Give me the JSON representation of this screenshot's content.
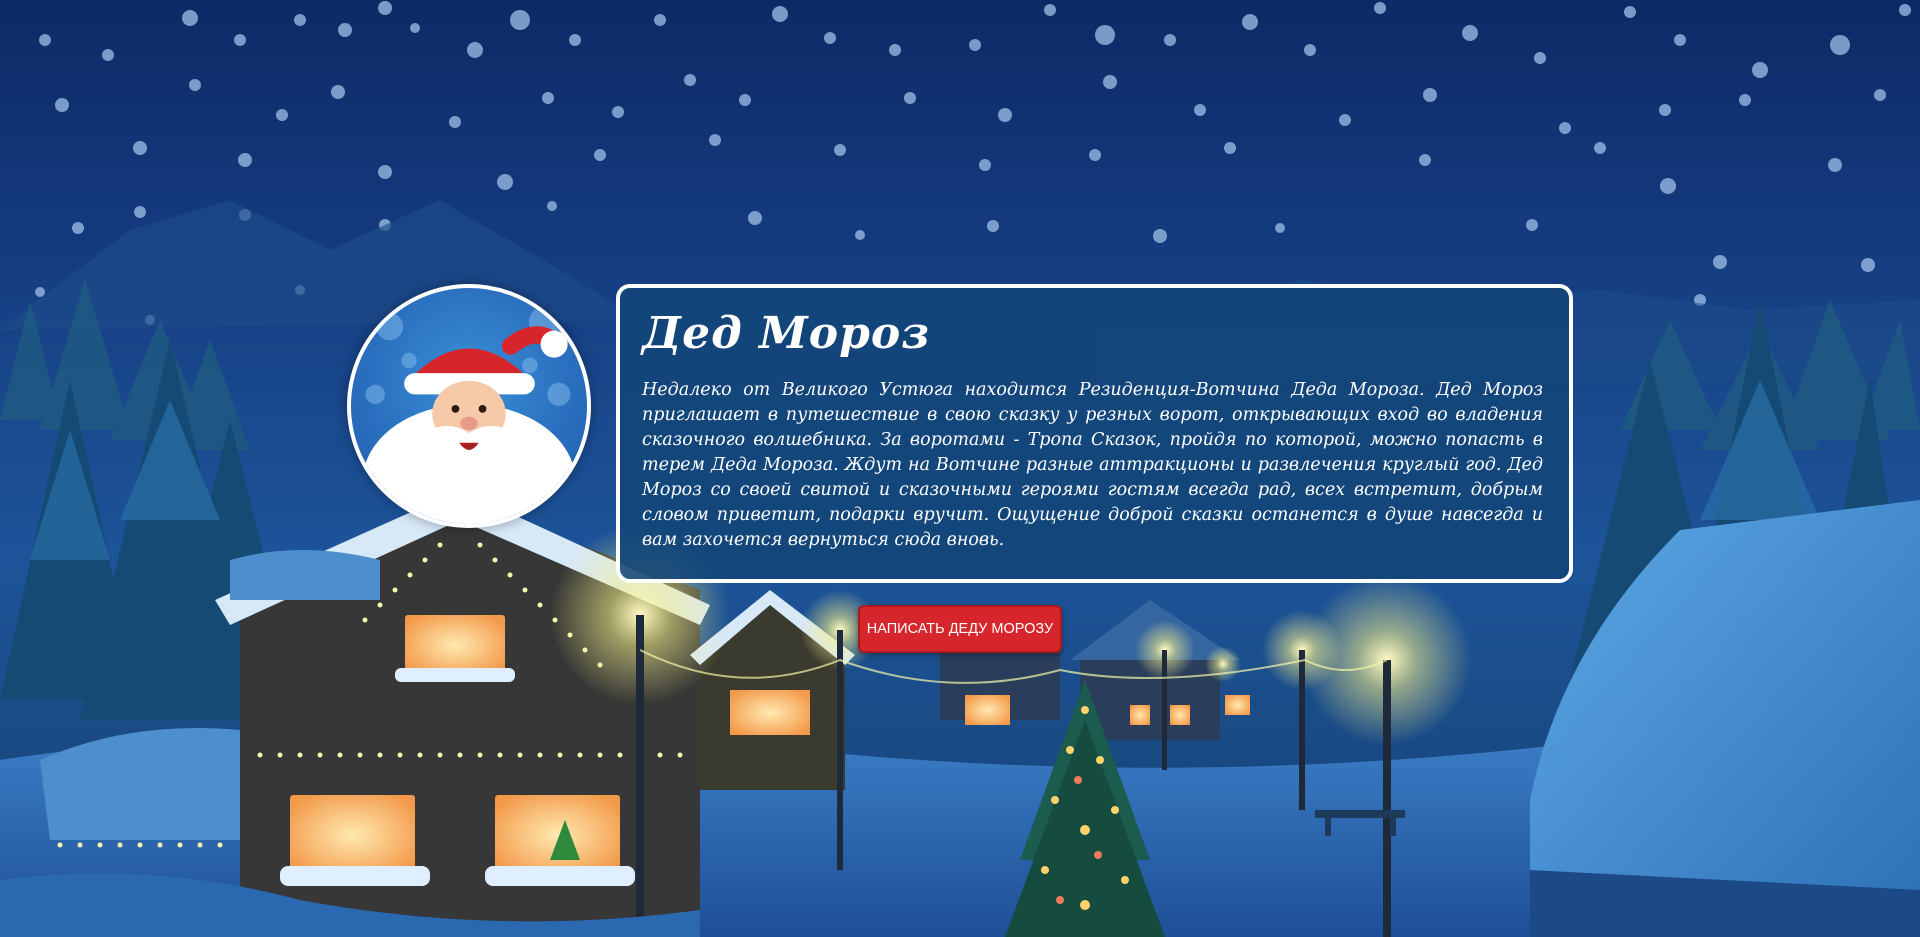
{
  "card": {
    "title": "Дед Мороз",
    "text": "Недалеко от Великого Устюга находится Резиденция-Вотчина Деда Мороза. Дед Мороз приглашает в путешествие в свою сказку у резных ворот, открывающих вход во владения сказочного волшебника. За воротами - Тропа Сказок, пройдя по которой, можно попасть в терем Деда Мороза. Ждут на Вотчине разные аттракционы и развлечения круглый год. Дед Мороз со своей свитой и сказочными героями гостям всегда рад, всех встретит, добрым словом приветит, подарки вручит. Ощущение доброй сказки останется в душе навсегда и вам захочется вернуться сюда вновь."
  },
  "actions": {
    "write_button_label": "НАПИСАТЬ ДЕДУ МОРОЗУ"
  },
  "icons": {
    "avatar": "santa-claus-avatar-icon"
  },
  "colors": {
    "button_red": "#d7262b",
    "card_bg": "#124678",
    "night_sky": "#0d2a66"
  }
}
